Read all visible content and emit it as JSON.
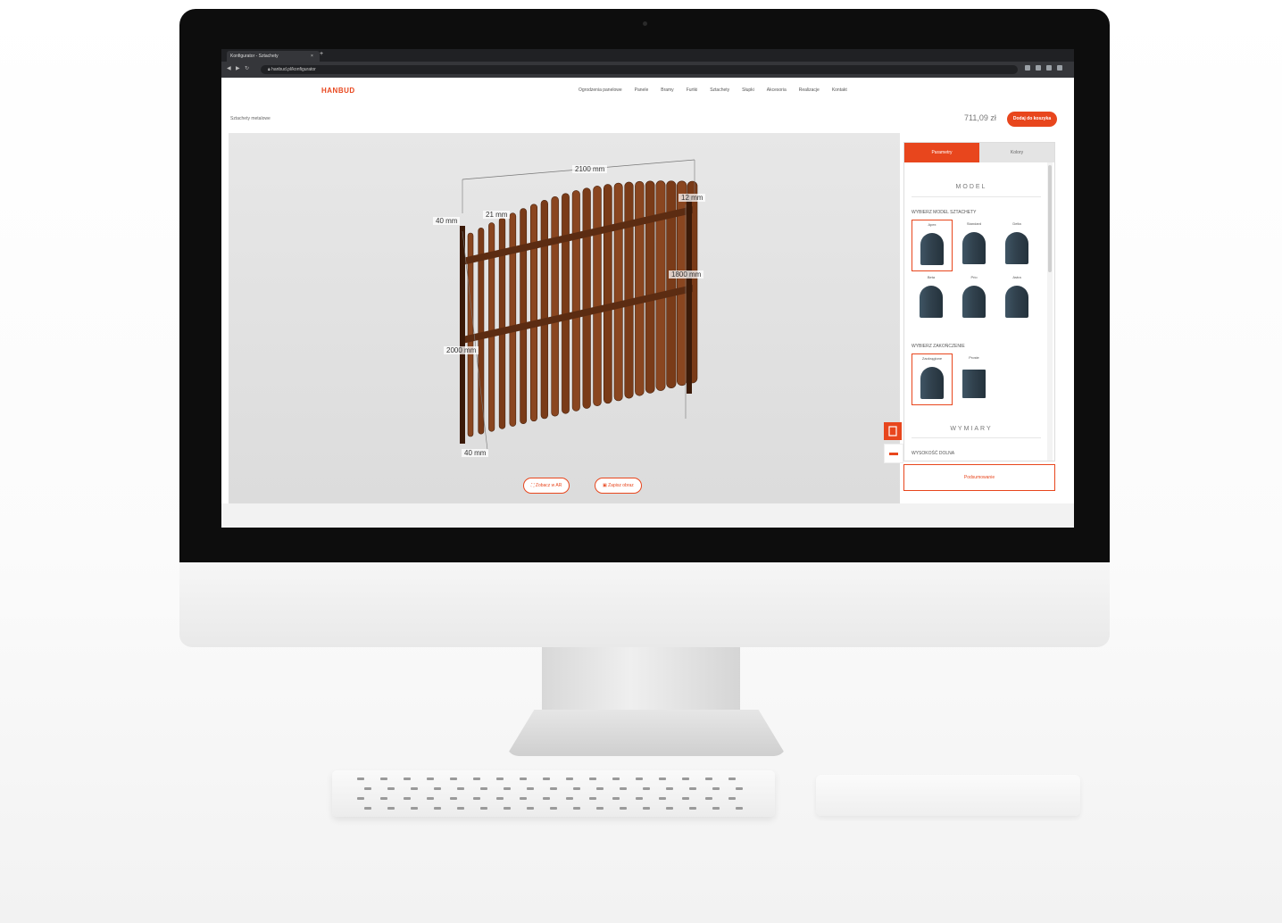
{
  "browser": {
    "tab_title": "Konfigurator - Sztachety",
    "tab_close": "×",
    "new_tab": "+",
    "url": "hanbud.pl/konfigurator"
  },
  "site": {
    "logo": "HANBUD",
    "menu": [
      "Ogrodzenia panelowe",
      "Panele",
      "Bramy",
      "Furtki",
      "Sztachety",
      "Słupki",
      "Akcesoria",
      "Realizacje",
      "Kontakt"
    ]
  },
  "subbar": {
    "breadcrumb": "Sztachety metalowe",
    "price": "711,09 zł",
    "buy_label": "Dodaj do koszyka"
  },
  "dimensions": {
    "width": "2100 mm",
    "gap_top": "21 mm",
    "top_left": "40 mm",
    "top_right": "12 mm",
    "height_right": "1800 mm",
    "height_left": "2000 mm",
    "bottom": "40 mm"
  },
  "view_buttons": {
    "ar": "Zobacz w AR",
    "save": "Zapisz obraz"
  },
  "panel": {
    "tab_active": "Parametry",
    "tab_other": "Kolory",
    "section_model": "MODEL",
    "choose_model": "WYBIERZ MODEL SZTACHETY",
    "models": [
      "Apex",
      "Standard",
      "Delta",
      "Beta",
      "Prio",
      "Astra"
    ],
    "choose_finish": "WYBIERZ ZAKOŃCZENIE",
    "finishes": [
      "Zaokrąglone",
      "Proste"
    ],
    "section_dims": "WYMIARY",
    "height_label": "WYSOKOŚĆ DOLNA",
    "summary_button": "Podsumowanie"
  },
  "colors": {
    "accent": "#e8461d",
    "fence": "#7a3b18",
    "picket_model": "#3f5564"
  },
  "icons": [
    "back-arrow-icon",
    "forward-arrow-icon",
    "reload-icon",
    "lock-icon",
    "fullscreen-icon",
    "image-icon",
    "save-icon",
    "ruler-icon"
  ]
}
